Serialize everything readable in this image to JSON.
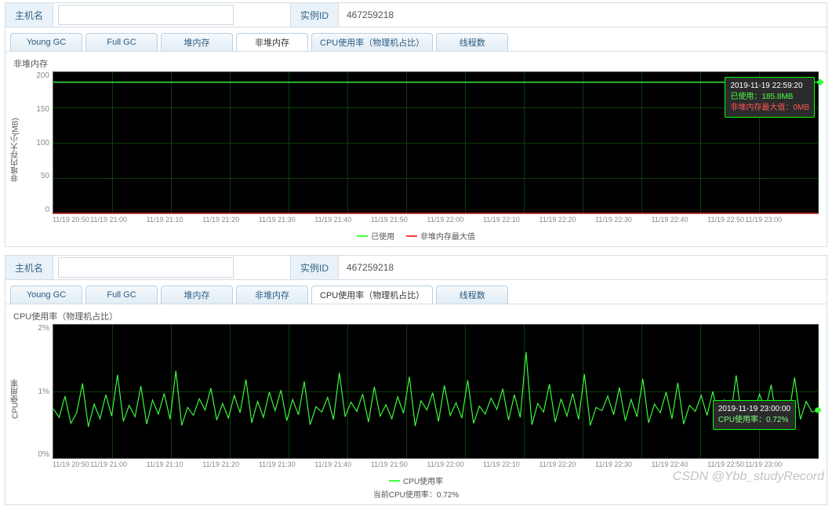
{
  "panel1": {
    "host_label": "主机名",
    "host_value": "",
    "id_label": "实例ID",
    "id_value": "467259218",
    "tabs": [
      "Young GC",
      "Full GC",
      "堆内存",
      "非堆内存",
      "CPU使用率（物理机占比）",
      "线程数"
    ],
    "active_tab": 3,
    "title": "非堆内存",
    "y_title": "非堆内存大小(MB)",
    "legend_used": "已使用",
    "legend_max": "非堆内存最大值",
    "tooltip": {
      "time": "2019-11-19 22:59:20",
      "used": "已使用：185.8MB",
      "max": "非堆内存最大值：0MB"
    }
  },
  "panel2": {
    "host_label": "主机名",
    "host_value": "",
    "id_label": "实例ID",
    "id_value": "467259218",
    "tabs": [
      "Young GC",
      "Full GC",
      "堆内存",
      "非堆内存",
      "CPU使用率（物理机占比）",
      "线程数"
    ],
    "active_tab": 4,
    "title": "CPU使用率（物理机占比）",
    "y_title": "CPU使用率",
    "legend_cpu": "CPU使用率",
    "current_label": "当前CPU使用率：0.72%",
    "tooltip": {
      "time": "2019-11-19 23:00:00",
      "cpu": "CPU使用率：0.72%"
    }
  },
  "watermark": "CSDN @Ybb_studyRecord",
  "chart_data": [
    {
      "type": "line",
      "title": "非堆内存",
      "xlabel": "",
      "ylabel": "非堆内存大小(MB)",
      "ylim": [
        0,
        200
      ],
      "x_ticks": [
        "11/19 20:50",
        "11/19 21:00",
        "11/19 21:10",
        "11/19 21:20",
        "11/19 21:30",
        "11/19 21:40",
        "11/19 21:50",
        "11/19 22:00",
        "11/19 22:10",
        "11/19 22:20",
        "11/19 22:30",
        "11/19 22:40",
        "11/19 22:50",
        "11/19 23:00"
      ],
      "y_ticks": [
        0,
        50,
        100,
        150,
        200
      ],
      "series": [
        {
          "name": "已使用",
          "color": "#3bff3b",
          "values": [
            185.8,
            185.8,
            185.8,
            185.8,
            185.8,
            185.8,
            185.8,
            185.8,
            185.8,
            185.8,
            185.8,
            185.8,
            185.8,
            185.8
          ]
        },
        {
          "name": "非堆内存最大值",
          "color": "#ff3b3b",
          "values": [
            0,
            0,
            0,
            0,
            0,
            0,
            0,
            0,
            0,
            0,
            0,
            0,
            0,
            0
          ]
        }
      ]
    },
    {
      "type": "line",
      "title": "CPU使用率（物理机占比）",
      "xlabel": "",
      "ylabel": "CPU使用率",
      "ylim": [
        0,
        2
      ],
      "y_unit": "%",
      "x_ticks": [
        "11/19 20:50",
        "11/19 21:00",
        "11/19 21:10",
        "11/19 21:20",
        "11/19 21:30",
        "11/19 21:40",
        "11/19 21:50",
        "11/19 22:00",
        "11/19 22:10",
        "11/19 22:20",
        "11/19 22:30",
        "11/19 22:40",
        "11/19 22:50",
        "11/19 23:00"
      ],
      "y_ticks": [
        "0%",
        "1%",
        "2%"
      ],
      "series": [
        {
          "name": "CPU使用率",
          "color": "#3bff3b",
          "current": 0.72,
          "values": [
            0.74,
            0.61,
            0.93,
            0.52,
            0.68,
            1.12,
            0.47,
            0.81,
            0.59,
            0.95,
            0.63,
            1.25,
            0.55,
            0.79,
            0.62,
            1.08,
            0.51,
            0.87,
            0.66,
            0.97,
            0.58,
            1.31,
            0.49,
            0.76,
            0.64,
            0.89,
            0.72,
            1.05,
            0.57,
            0.82,
            0.6,
            0.94,
            0.68,
            1.18,
            0.53,
            0.85,
            0.61,
            0.99,
            0.71,
            1.02,
            0.56,
            0.88,
            0.65,
            1.15,
            0.5,
            0.77,
            0.69,
            0.91,
            0.58,
            1.28,
            0.62,
            0.84,
            0.7,
            0.96,
            0.54,
            1.07,
            0.63,
            0.8,
            0.59,
            0.92,
            0.67,
            1.22,
            0.48,
            0.86,
            0.72,
            0.98,
            0.55,
            1.09,
            0.64,
            0.83,
            0.6,
            1.17,
            0.52,
            0.78,
            0.66,
            0.9,
            0.73,
            1.04,
            0.57,
            0.95,
            0.61,
            1.59,
            0.5,
            0.82,
            0.69,
            1.11,
            0.54,
            0.89,
            0.63,
            0.97,
            0.58,
            1.26,
            0.49,
            0.76,
            0.71,
            0.93,
            0.65,
            1.06,
            0.56,
            0.88,
            0.62,
            1.19,
            0.53,
            0.81,
            0.68,
            0.99,
            0.59,
            1.13,
            0.51,
            0.79,
            0.7,
            0.94,
            0.64,
            1.0,
            0.57,
            0.87,
            0.6,
            1.24,
            0.55,
            0.83,
            0.67,
            0.96,
            0.72,
            1.1,
            0.52,
            0.78,
            0.63,
            1.21,
            0.58,
            0.85,
            0.69,
            0.72
          ]
        }
      ]
    }
  ]
}
